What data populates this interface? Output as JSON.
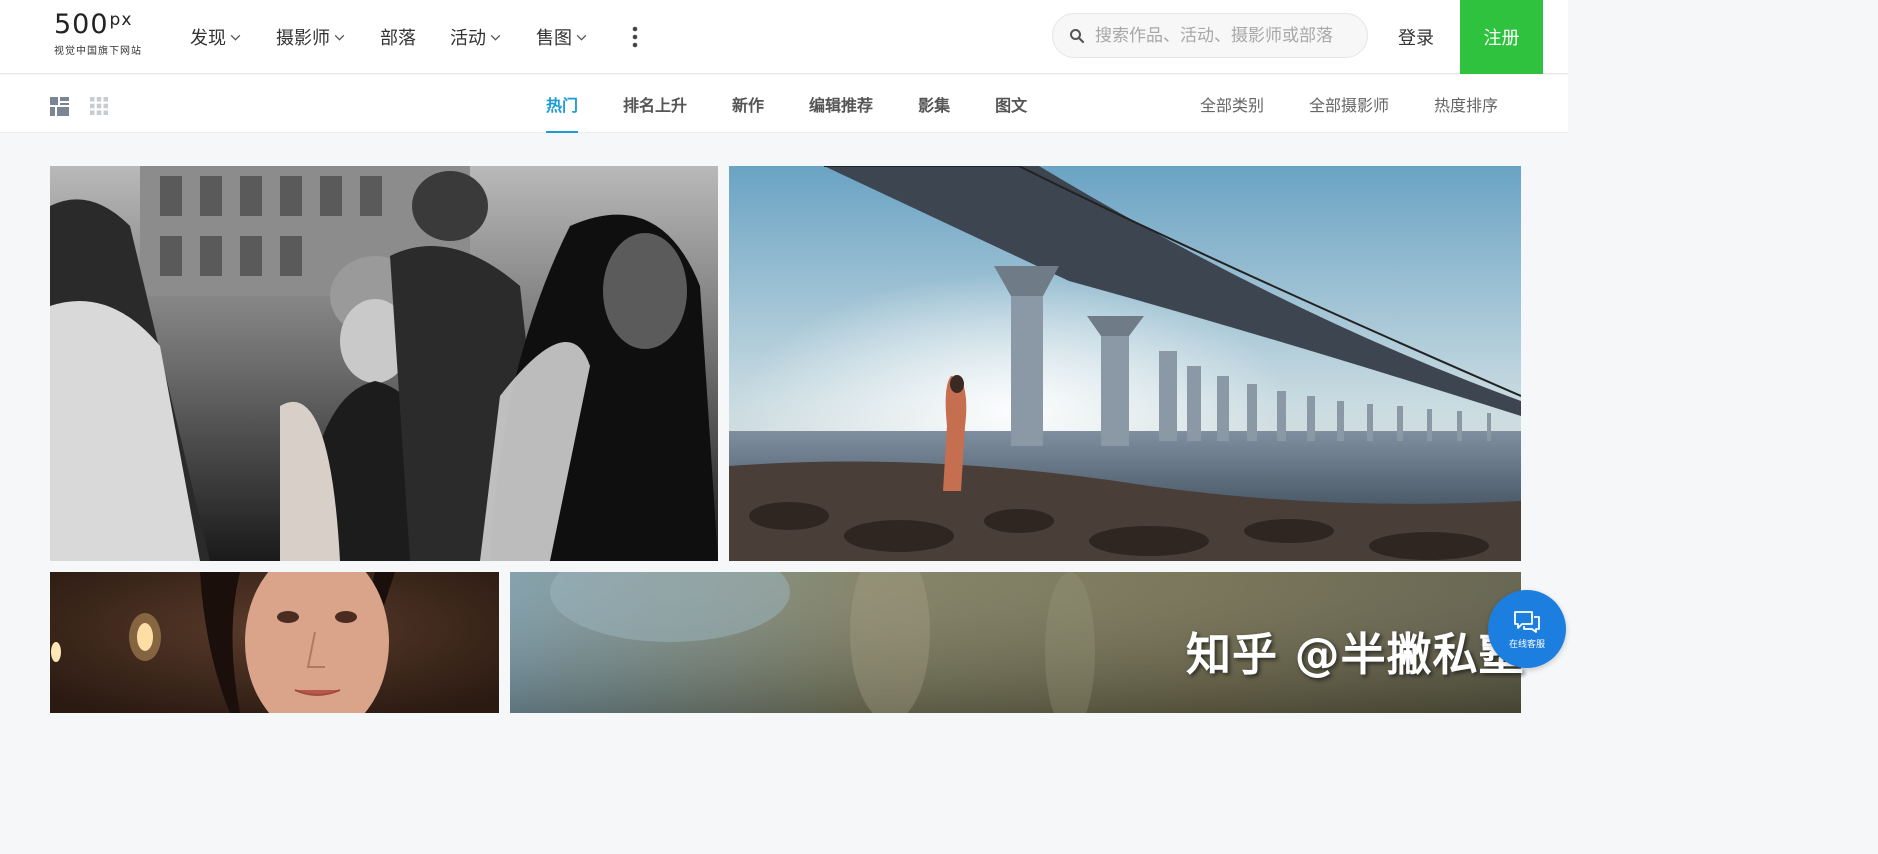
{
  "header": {
    "logo_text": "500",
    "logo_sup": "px",
    "logo_sub": "视觉中国旗下网站",
    "nav": [
      {
        "label": "发现",
        "has_dropdown": true
      },
      {
        "label": "摄影师",
        "has_dropdown": true
      },
      {
        "label": "部落",
        "has_dropdown": false
      },
      {
        "label": "活动",
        "has_dropdown": true
      },
      {
        "label": "售图",
        "has_dropdown": true
      }
    ],
    "search_placeholder": "搜索作品、活动、摄影师或部落",
    "login_label": "登录",
    "register_label": "注册"
  },
  "subnav": {
    "tabs": [
      {
        "label": "热门",
        "active": true
      },
      {
        "label": "排名上升",
        "active": false
      },
      {
        "label": "新作",
        "active": false
      },
      {
        "label": "编辑推荐",
        "active": false
      },
      {
        "label": "影集",
        "active": false
      },
      {
        "label": "图文",
        "active": false
      }
    ],
    "filters": [
      "全部类别",
      "全部摄影师",
      "热度排序"
    ]
  },
  "watermark": "知乎 @半撇私塾",
  "chat_widget": {
    "label": "在线客服"
  },
  "colors": {
    "accent": "#1e9bd7",
    "register_bg": "#2ec23f",
    "chat_bg": "#1c7fe0"
  }
}
